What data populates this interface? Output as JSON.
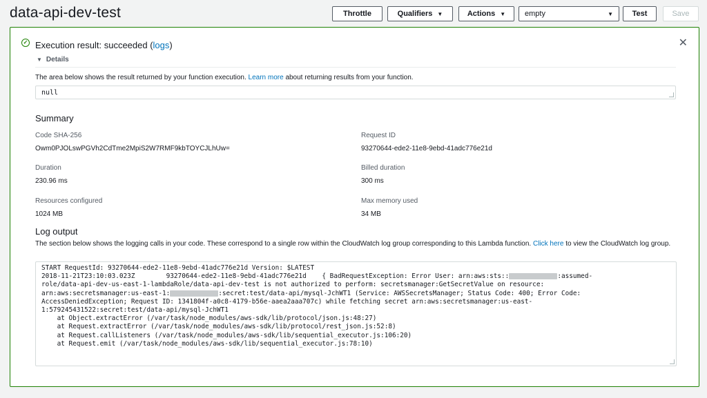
{
  "header": {
    "function_name": "data-api-dev-test",
    "throttle_label": "Throttle",
    "qualifiers_label": "Qualifiers",
    "actions_label": "Actions",
    "test_event_value": "empty",
    "test_label": "Test",
    "save_label": "Save"
  },
  "result": {
    "title_prefix": "Execution result: succeeded (",
    "logs_link": "logs",
    "title_suffix": ")",
    "details_label": "Details",
    "intro_text": "The area below shows the result returned by your function execution.",
    "learn_more": "Learn more",
    "intro_suffix": "about returning results from your function.",
    "returned_value": "null"
  },
  "summary": {
    "title": "Summary",
    "code_sha_label": "Code SHA-256",
    "code_sha_value": "Owm0PJOLswPGVh2CdTme2MpiS2W7RMF9kbTOYCJLhUw=",
    "request_id_label": "Request ID",
    "request_id_value": "93270644-ede2-11e8-9ebd-41adc776e21d",
    "duration_label": "Duration",
    "duration_value": "230.96 ms",
    "billed_label": "Billed duration",
    "billed_value": "300 ms",
    "resources_label": "Resources configured",
    "resources_value": "1024 MB",
    "max_memory_label": "Max memory used",
    "max_memory_value": "34 MB"
  },
  "log": {
    "title": "Log output",
    "intro_text": "The section below shows the logging calls in your code. These correspond to a single row within the CloudWatch log group corresponding to this Lambda function.",
    "click_here": "Click here",
    "intro_suffix": "to view the CloudWatch log group.",
    "line1": "START RequestId: 93270644-ede2-11e8-9ebd-41adc776e21d Version: $LATEST",
    "line2a": "2018-11-21T23:10:03.023Z        93270644-ede2-11e8-9ebd-41adc776e21d    { BadRequestException: Error User: arn:aws:sts::",
    "line2b": ":assumed-",
    "line3": "role/data-api-dev-us-east-1-lambdaRole/data-api-dev-test is not authorized to perform: secretsmanager:GetSecretValue on resource:",
    "line4a": "arn:aws:secretsmanager:us-east-1:",
    "line4b": ":secret:test/data-api/mysql-JchWT1 (Service: AWSSecretsManager; Status Code: 400; Error Code:",
    "line5": "AccessDeniedException; Request ID: 1341804f-a0c8-4179-b56e-aaea2aaa707c) while fetching secret arn:aws:secretsmanager:us-east-",
    "line6": "1:579245431522:secret:test/data-api/mysql-JchWT1",
    "line7": "    at Object.extractError (/var/task/node_modules/aws-sdk/lib/protocol/json.js:48:27)",
    "line8": "    at Request.extractError (/var/task/node_modules/aws-sdk/lib/protocol/rest_json.js:52:8)",
    "line9": "    at Request.callListeners (/var/task/node_modules/aws-sdk/lib/sequential_executor.js:106:20)",
    "line10": "    at Request.emit (/var/task/node_modules/aws-sdk/lib/sequential_executor.js:78:10)"
  },
  "colors": {
    "success": "#1d8102",
    "link": "#0073bb",
    "background": "#f2f3f3"
  },
  "icons": {
    "status": "check-circle-icon",
    "close": "close-icon",
    "caret": "caret-down-icon",
    "details": "triangle-down-icon"
  }
}
